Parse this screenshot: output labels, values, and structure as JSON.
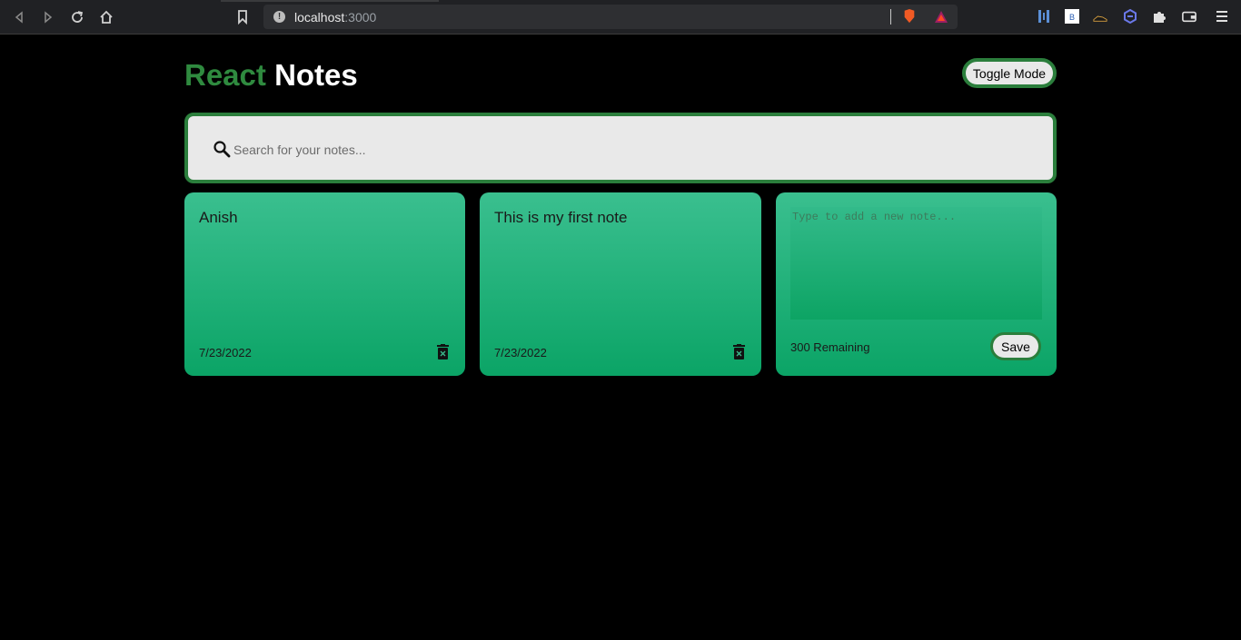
{
  "browser": {
    "url_host": "localhost",
    "url_port": ":3000"
  },
  "header": {
    "title_part1": "React",
    "title_part2": "Notes",
    "toggle_label": "Toggle Mode"
  },
  "search": {
    "placeholder": "Search for your notes..."
  },
  "notes": [
    {
      "text": "Anish",
      "date": "7/23/2022"
    },
    {
      "text": "This is my first note",
      "date": "7/23/2022"
    }
  ],
  "new_note": {
    "placeholder": "Type to add a new note...",
    "remaining": "300 Remaining",
    "save_label": "Save"
  },
  "colors": {
    "background": "#000000",
    "accent_green": "#2f8a3f",
    "card_gradient_top": "#3abf8f",
    "card_gradient_bottom": "#0ba466"
  }
}
